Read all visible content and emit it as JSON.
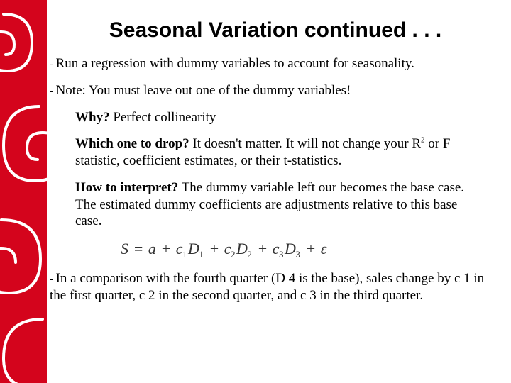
{
  "title": "Seasonal Variation continued . . .",
  "bullets": {
    "b1": "Run a regression with dummy variables to account for seasonality.",
    "b2": "Note: You must leave out one of the dummy variables!",
    "b3": "In a comparison with the fourth quarter (D 4 is the base), sales change by c 1 in the first quarter, c 2 in the second quarter, and c 3 in the third quarter."
  },
  "subs": {
    "why_label": "Why?",
    "why_ans": " Perfect collinearity",
    "drop_label": "Which one to drop?",
    "drop_ans": " It doesn't matter. It will not change your R",
    "drop_ans_tail": " or F statistic, coefficient estimates, or their t-statistics.",
    "interp_label": "How to interpret?",
    "interp_ans": " The dummy variable left our becomes the base case. The estimated dummy coefficients are adjustments relative to this base case."
  },
  "equation": {
    "lhs": "S",
    "eq": " = ",
    "a": "a",
    "plus": " + ",
    "c": "c",
    "D": "D",
    "eps": "ε",
    "idx1": "1",
    "idx2": "2",
    "idx3": "3",
    "two": "2"
  },
  "dash": "- "
}
